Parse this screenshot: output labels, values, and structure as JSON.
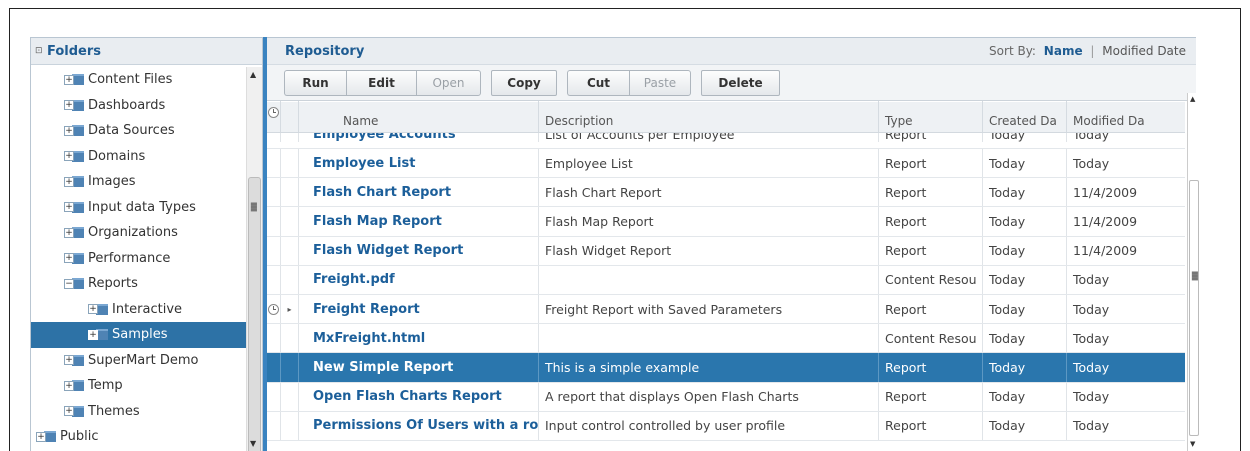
{
  "folders": {
    "title": "Folders",
    "collapse_glyph": "⊡",
    "items": [
      {
        "label": "Content Files",
        "level": 1
      },
      {
        "label": "Dashboards",
        "level": 1
      },
      {
        "label": "Data Sources",
        "level": 1
      },
      {
        "label": "Domains",
        "level": 1
      },
      {
        "label": "Images",
        "level": 1
      },
      {
        "label": "Input data Types",
        "level": 1
      },
      {
        "label": "Organizations",
        "level": 1
      },
      {
        "label": "Performance",
        "level": 1
      },
      {
        "label": "Reports",
        "level": 1,
        "expanded": true
      },
      {
        "label": "Interactive",
        "level": 2
      },
      {
        "label": "Samples",
        "level": 2,
        "selected": true
      },
      {
        "label": "SuperMart Demo",
        "level": 1
      },
      {
        "label": "Temp",
        "level": 1
      },
      {
        "label": "Themes",
        "level": 1
      },
      {
        "label": "Public",
        "level": 0
      }
    ]
  },
  "repository": {
    "title": "Repository",
    "sort_by_label": "Sort By:",
    "sort_active": "Name",
    "sort_other": "Modified Date"
  },
  "toolbar": {
    "run": "Run",
    "edit": "Edit",
    "open": "Open",
    "copy": "Copy",
    "cut": "Cut",
    "paste": "Paste",
    "delete": "Delete"
  },
  "grid": {
    "headers": {
      "name": "Name",
      "description": "Description",
      "type": "Type",
      "created": "Created Da",
      "modified": "Modified Da"
    },
    "rows": [
      {
        "name": "Employee Accounts",
        "description": "List of Accounts per Employee",
        "type": "Report",
        "created": "Today",
        "modified": "Today"
      },
      {
        "name": "Employee List",
        "description": "Employee List",
        "type": "Report",
        "created": "Today",
        "modified": "Today"
      },
      {
        "name": "Flash Chart Report",
        "description": "Flash Chart Report",
        "type": "Report",
        "created": "Today",
        "modified": "11/4/2009"
      },
      {
        "name": "Flash Map Report",
        "description": "Flash Map Report",
        "type": "Report",
        "created": "Today",
        "modified": "11/4/2009"
      },
      {
        "name": "Flash Widget Report",
        "description": "Flash Widget Report",
        "type": "Report",
        "created": "Today",
        "modified": "11/4/2009"
      },
      {
        "name": "Freight.pdf",
        "description": "",
        "type": "Content Resou",
        "created": "Today",
        "modified": "Today"
      },
      {
        "name": "Freight Report",
        "description": "Freight Report with Saved Parameters",
        "type": "Report",
        "created": "Today",
        "modified": "Today",
        "scheduled": true
      },
      {
        "name": "MxFreight.html",
        "description": "",
        "type": "Content Resou",
        "created": "Today",
        "modified": "Today"
      },
      {
        "name": "New Simple Report",
        "description": "This is a simple example",
        "type": "Report",
        "created": "Today",
        "modified": "Today",
        "selected": true
      },
      {
        "name": "Open Flash Charts Report",
        "description": "A report that displays Open Flash Charts",
        "type": "Report",
        "created": "Today",
        "modified": "Today"
      },
      {
        "name": "Permissions Of Users with a ro",
        "description": "Input control controlled by user profile",
        "type": "Report",
        "created": "Today",
        "modified": "Today"
      }
    ]
  },
  "colors": {
    "accent": "#2a76ad",
    "link": "#1c5f9a",
    "header_bg": "#e9edf1"
  }
}
